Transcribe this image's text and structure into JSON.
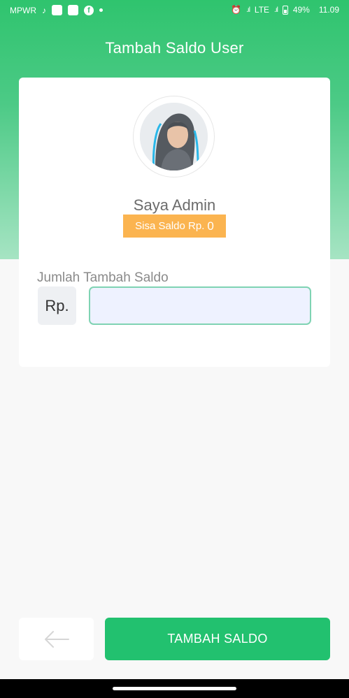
{
  "status_bar": {
    "carrier": "MPWR",
    "network": "LTE",
    "battery": "49%",
    "time": "11.09"
  },
  "header": {
    "title": "Tambah Saldo User"
  },
  "profile": {
    "name": "Saya Admin",
    "balance_label": "Sisa Saldo Rp.",
    "balance_value": "0"
  },
  "form": {
    "amount_label": "Jumlah Tambah Saldo",
    "currency_prefix": "Rp.",
    "amount_value": ""
  },
  "actions": {
    "back_icon": "arrow-left-icon",
    "submit_label": "TAMBAH SALDO"
  },
  "colors": {
    "primary": "#22c16f",
    "badge": "#fbb450",
    "input_border": "#7fd3b3",
    "input_bg": "#eef2ff"
  }
}
